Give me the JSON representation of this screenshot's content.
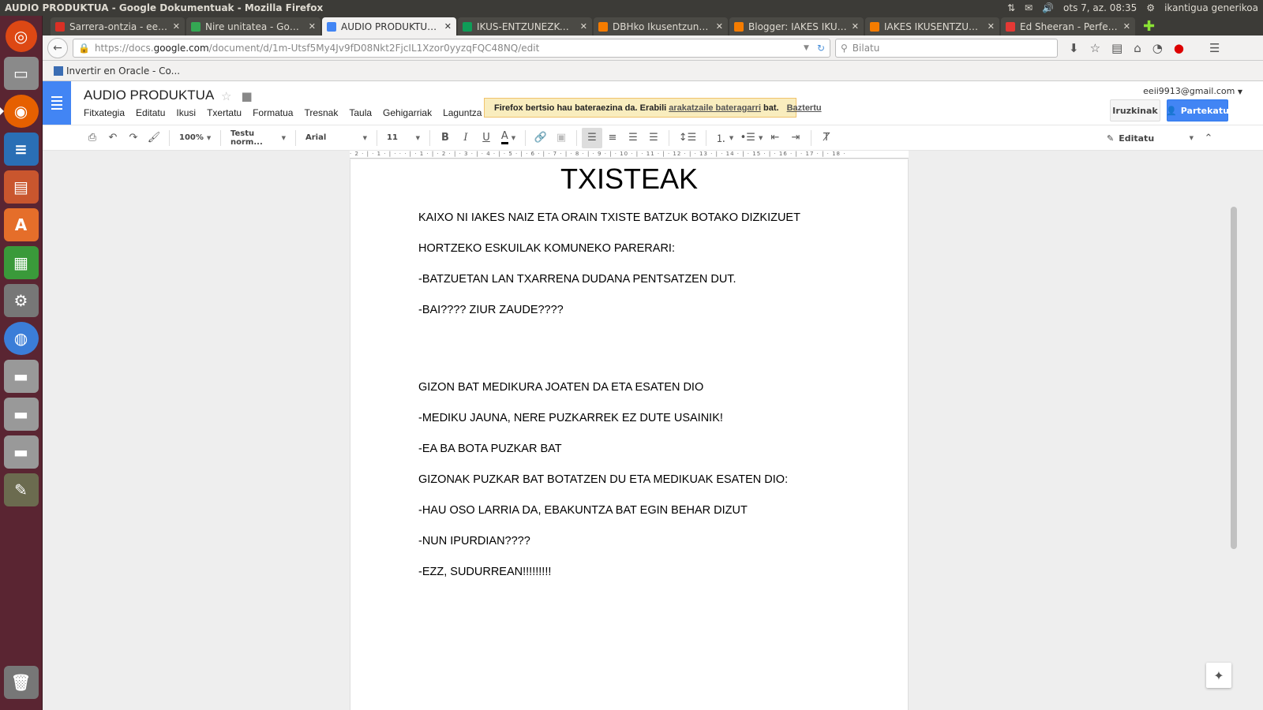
{
  "os_panel": {
    "window_title": "AUDIO PRODUKTUA - Google Dokumentuak - Mozilla Firefox",
    "datetime": "ots 7, az. 08:35",
    "user": "ikantigua generikoa"
  },
  "launcher": {
    "items": [
      "ubuntu-home",
      "files",
      "firefox",
      "writer",
      "impress",
      "software-center",
      "calc",
      "settings",
      "chromium",
      "drive-1",
      "drive-2",
      "drive-3",
      "gimp",
      "trash"
    ]
  },
  "tabs": [
    {
      "label": "Sarrera-ontzia - eeii...",
      "color": "#d93025"
    },
    {
      "label": "Nire unitatea - Goog...",
      "color": "#34a853"
    },
    {
      "label": "AUDIO PRODUKTUA ...",
      "color": "#4285f4"
    },
    {
      "label": "IKUS-ENTZUNEZKO ...",
      "color": "#0f9d58"
    },
    {
      "label": "DBHko Ikusentzunez...",
      "color": "#f57c00"
    },
    {
      "label": "Blogger: IAKES IKUS...",
      "color": "#f57c00"
    },
    {
      "label": "IAKES IKUSENTZUN...",
      "color": "#f57c00"
    },
    {
      "label": "Ed Sheeran - Perfect...",
      "color": "#e53935"
    }
  ],
  "navbar": {
    "url_prefix": "https://docs.",
    "url_host": "google.com",
    "url_path": "/document/d/1m-Utsf5My4Jv9fD08Nkt2FjcIL1Xzor0yyzqFQC48NQ/edit",
    "search_placeholder": "Bilatu"
  },
  "bookmarks": [
    {
      "label": "Invertir en Oracle - Co..."
    }
  ],
  "docs": {
    "title": "AUDIO PRODUKTUA",
    "account_email": "eeii9913@gmail.com",
    "menu": [
      "Fitxategia",
      "Editatu",
      "Ikusi",
      "Txertatu",
      "Formatua",
      "Tresnak",
      "Taula",
      "Gehigarriak",
      "Laguntza"
    ],
    "warning": {
      "text_before": "Firefox bertsio hau bateraezina da. Erabili",
      "link": "arakatzaile bateragarri",
      "text_after": "bat.",
      "dismiss": "Baztertu"
    },
    "comments_label": "Iruzkinak",
    "share_label": "Partekatu"
  },
  "toolbar": {
    "zoom": "100%",
    "style": "Testu norm...",
    "font": "Arial",
    "size": "11",
    "edit_mode": "Editatu"
  },
  "ruler_text": "· 2 · | · 1 · | · · · | · 1 · | · 2 · | · 3 · | · 4 · | · 5 · | · 6 · | · 7 · | · 8 · | · 9 · | · 10 · | · 11 · | · 12 · | · 13 · | · 14 · | · 15 · | · 16 · | · 17 · | · 18 ·",
  "document": {
    "heading": "TXISTEAK",
    "lines": [
      "KAIXO NI IAKES NAIZ ETA ORAIN TXISTE BATZUK BOTAKO DIZKIZUET",
      "HORTZEKO ESKUILAK KOMUNEKO PARERARI:",
      "-BATZUETAN LAN TXARRENA DUDANA PENTSATZEN DUT.",
      "-BAI???? ZIUR ZAUDE????",
      "GIZON BAT MEDIKURA JOATEN DA ETA ESATEN DIO",
      "-MEDIKU JAUNA, NERE PUZKARREK EZ DUTE USAINIK!",
      "-EA BA BOTA PUZKAR BAT",
      "GIZONAK PUZKAR BAT BOTATZEN DU ETA MEDIKUAK ESATEN DIO:",
      "-HAU OSO LARRIA DA, EBAKUNTZA BAT EGIN BEHAR DIZUT",
      "-NUN IPURDIAN????",
      "-EZZ, SUDURREAN!!!!!!!!!"
    ]
  }
}
